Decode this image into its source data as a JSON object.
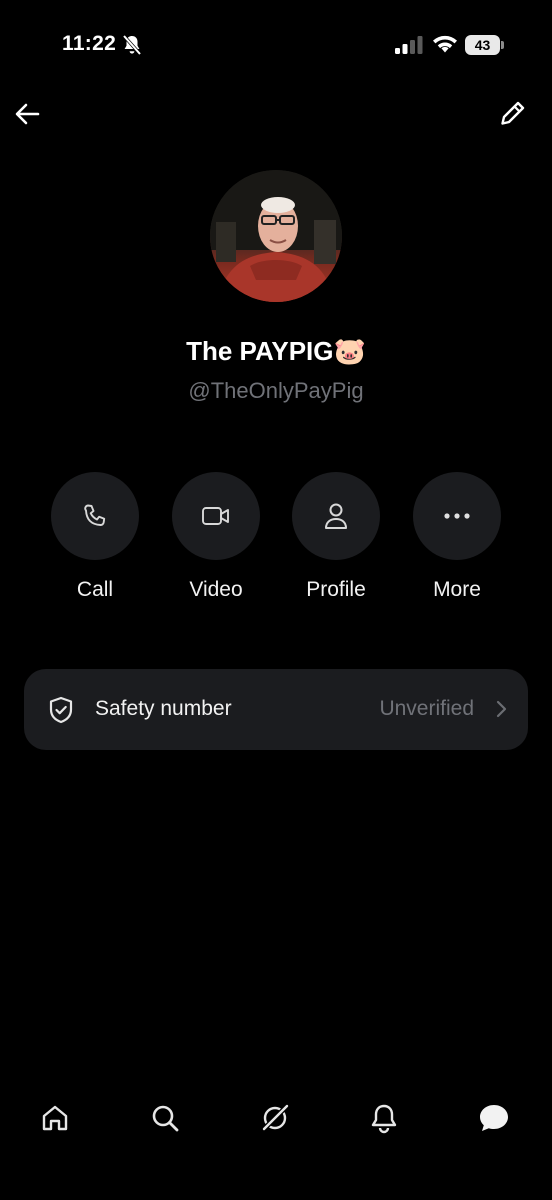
{
  "status_bar": {
    "time": "11:22",
    "battery": "43",
    "icons": [
      "bell-muted-icon",
      "signal-icon",
      "wifi-icon",
      "battery-icon"
    ]
  },
  "header": {
    "back_icon": "arrow-left-icon",
    "edit_icon": "pencil-icon"
  },
  "profile": {
    "display_name": "The PAYPIG🐷",
    "handle": "@TheOnlyPayPig"
  },
  "actions": [
    {
      "label": "Call",
      "icon": "phone-icon"
    },
    {
      "label": "Video",
      "icon": "video-camera-icon"
    },
    {
      "label": "Profile",
      "icon": "person-icon"
    },
    {
      "label": "More",
      "icon": "ellipsis-icon"
    }
  ],
  "safety": {
    "label": "Safety number",
    "status": "Unverified",
    "icon": "shield-check-icon"
  },
  "bottom_nav": [
    {
      "icon": "home-icon"
    },
    {
      "icon": "search-icon"
    },
    {
      "icon": "grok-icon"
    },
    {
      "icon": "bell-icon"
    },
    {
      "icon": "messages-icon"
    }
  ],
  "colors": {
    "background": "#000000",
    "surface": "#1b1c1f",
    "muted_text": "#707278",
    "primary_text": "#ffffff"
  }
}
